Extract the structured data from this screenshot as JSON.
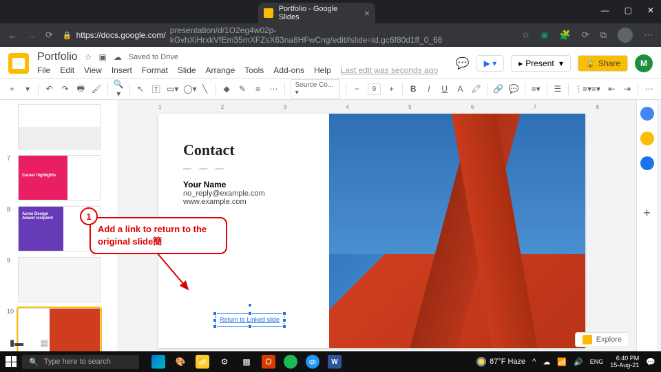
{
  "browser": {
    "tab_title": "Portfolio - Google Slides",
    "url_host": "https://docs.google.com/",
    "url_path": "presentation/d/1O2eg4w02p-kGvhXiHrxkVfEm35mXFZsX63na8HFwCng/edit#slide=id.gc6f80d1ff_0_66"
  },
  "doc": {
    "title": "Portfolio",
    "saved_status": "Saved to Drive",
    "last_edit": "Last edit was seconds ago",
    "user_initial": "M"
  },
  "menus": [
    "File",
    "Edit",
    "View",
    "Insert",
    "Format",
    "Slide",
    "Arrange",
    "Tools",
    "Add-ons",
    "Help"
  ],
  "header_buttons": {
    "present": "Present",
    "share": "Share"
  },
  "toolbar": {
    "font": "Source Co...",
    "size": "9"
  },
  "thumbs": [
    {
      "num": ""
    },
    {
      "num": "7",
      "label": "Career highlights"
    },
    {
      "num": "8",
      "label": "Acme Design Award recipient"
    },
    {
      "num": "9"
    },
    {
      "num": "10"
    }
  ],
  "slide": {
    "heading": "Contact",
    "name": "Your Name",
    "email": "no_reply@example.com",
    "website": "www.example.com",
    "link_text": "Return to Linked slide"
  },
  "callout": {
    "badge": "1",
    "text": "Add a link to return to the original slide"
  },
  "ruler_marks": [
    "1",
    "2",
    "3",
    "4",
    "5",
    "6",
    "7",
    "8"
  ],
  "explore_label": "Explore",
  "taskbar": {
    "search_placeholder": "Type here to search",
    "weather": "87°F Haze",
    "time": "6:40 PM",
    "date": "15-Aug-21"
  }
}
